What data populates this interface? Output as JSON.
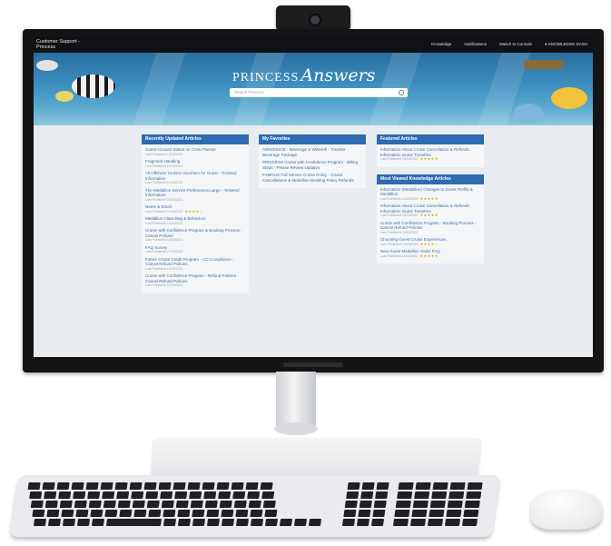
{
  "app": {
    "title_line1": "Customer Support -",
    "title_line2": "Princess"
  },
  "nav": {
    "items": [
      "Knowledge",
      "Notifications",
      "Switch to Console"
    ],
    "user": "KNOWLEDGE DASH"
  },
  "hero": {
    "logo_text": "PRINCESS",
    "logo_script": "Answers",
    "search_placeholder": "Search Princess"
  },
  "panels": {
    "recent": {
      "title": "Recently Updated Articles",
      "items": [
        {
          "title": "Guest Account Status on Crew Planner",
          "meta": "Last Published 10/18/2022"
        },
        {
          "title": "Fragment Handling",
          "meta": "Last Published 10/18/2022"
        },
        {
          "title": "All Offshore Cruises Vouchers for Guest - Ticketed Information",
          "meta": "Last Published 10/18/2022"
        },
        {
          "title": "The Medallion Service Preferences Large - Ticketed Information",
          "meta": "Last Published 10/18/2022"
        },
        {
          "title": "Name & Email",
          "meta": "Last Published 10/18/2022",
          "stars": "★★★★☆"
        },
        {
          "title": "Medallion Class Bag & Behaviors",
          "meta": "Last Published 10/18/2022"
        },
        {
          "title": "Cruise with Confidence Program & Booking Process - Cancel Policies",
          "meta": "Last Published 10/18/2022"
        },
        {
          "title": "FAQ Survey",
          "meta": "Last Published 10/18/2022"
        },
        {
          "title": "Future Cruise Credit Program - CO Compliance - Cancel Refund Policies",
          "meta": "Last Published 10/18/2022"
        },
        {
          "title": "Cruise with Confidence Program - Refund Policies - Cancel Refund Policies",
          "meta": "Last Published 10/18/2022"
        }
      ]
    },
    "favorites": {
      "title": "My Favorites",
      "items": [
        {
          "title": "ANNOUNCE - Beverage & Wine/All - Transfer Beverage Package"
        },
        {
          "title": "PRINCESS Cruise with Confidence Program - Billing Steps - Please Review Updates"
        },
        {
          "title": "FAMOUS Full Service Cruise Policy - Cruise Cancellations & Medallion Booking Policy Refunds"
        }
      ]
    },
    "featured": {
      "title": "Featured Articles",
      "items": [
        {
          "title": "Information About Cruise Cancellation & Refunds Information Guest Transfers",
          "meta": "Last Published 10/18/2022",
          "stars": "★★★★★"
        }
      ]
    },
    "most_viewed": {
      "title": "Most Viewed Knowledge Articles",
      "items": [
        {
          "title": "Information (Medallion) Changes to Guest Profile & Medallion",
          "meta": "Last Published 10/18/2022",
          "stars": "★★★★★"
        },
        {
          "title": "Information About Cruise Cancellation & Refunds Information Guest Transfers",
          "meta": "Last Published 10/18/2022",
          "stars": "★★★★★"
        },
        {
          "title": "Cruise with Confidence Program - Booking Process - Cancel Refund Policies",
          "meta": "Last Published 10/18/2022"
        },
        {
          "title": "Choosing Guest Cruise Experiences",
          "meta": "Last Published 10/18/2022",
          "stars": "★★★★☆"
        },
        {
          "title": "New Guest Medallion Order FAQ",
          "meta": "Last Published 10/18/2022",
          "stars": "★★★★★"
        }
      ]
    }
  },
  "colors": {
    "panel_header": "#2e6bb0",
    "link": "#3d6ea8",
    "stars": "#e0a800"
  }
}
